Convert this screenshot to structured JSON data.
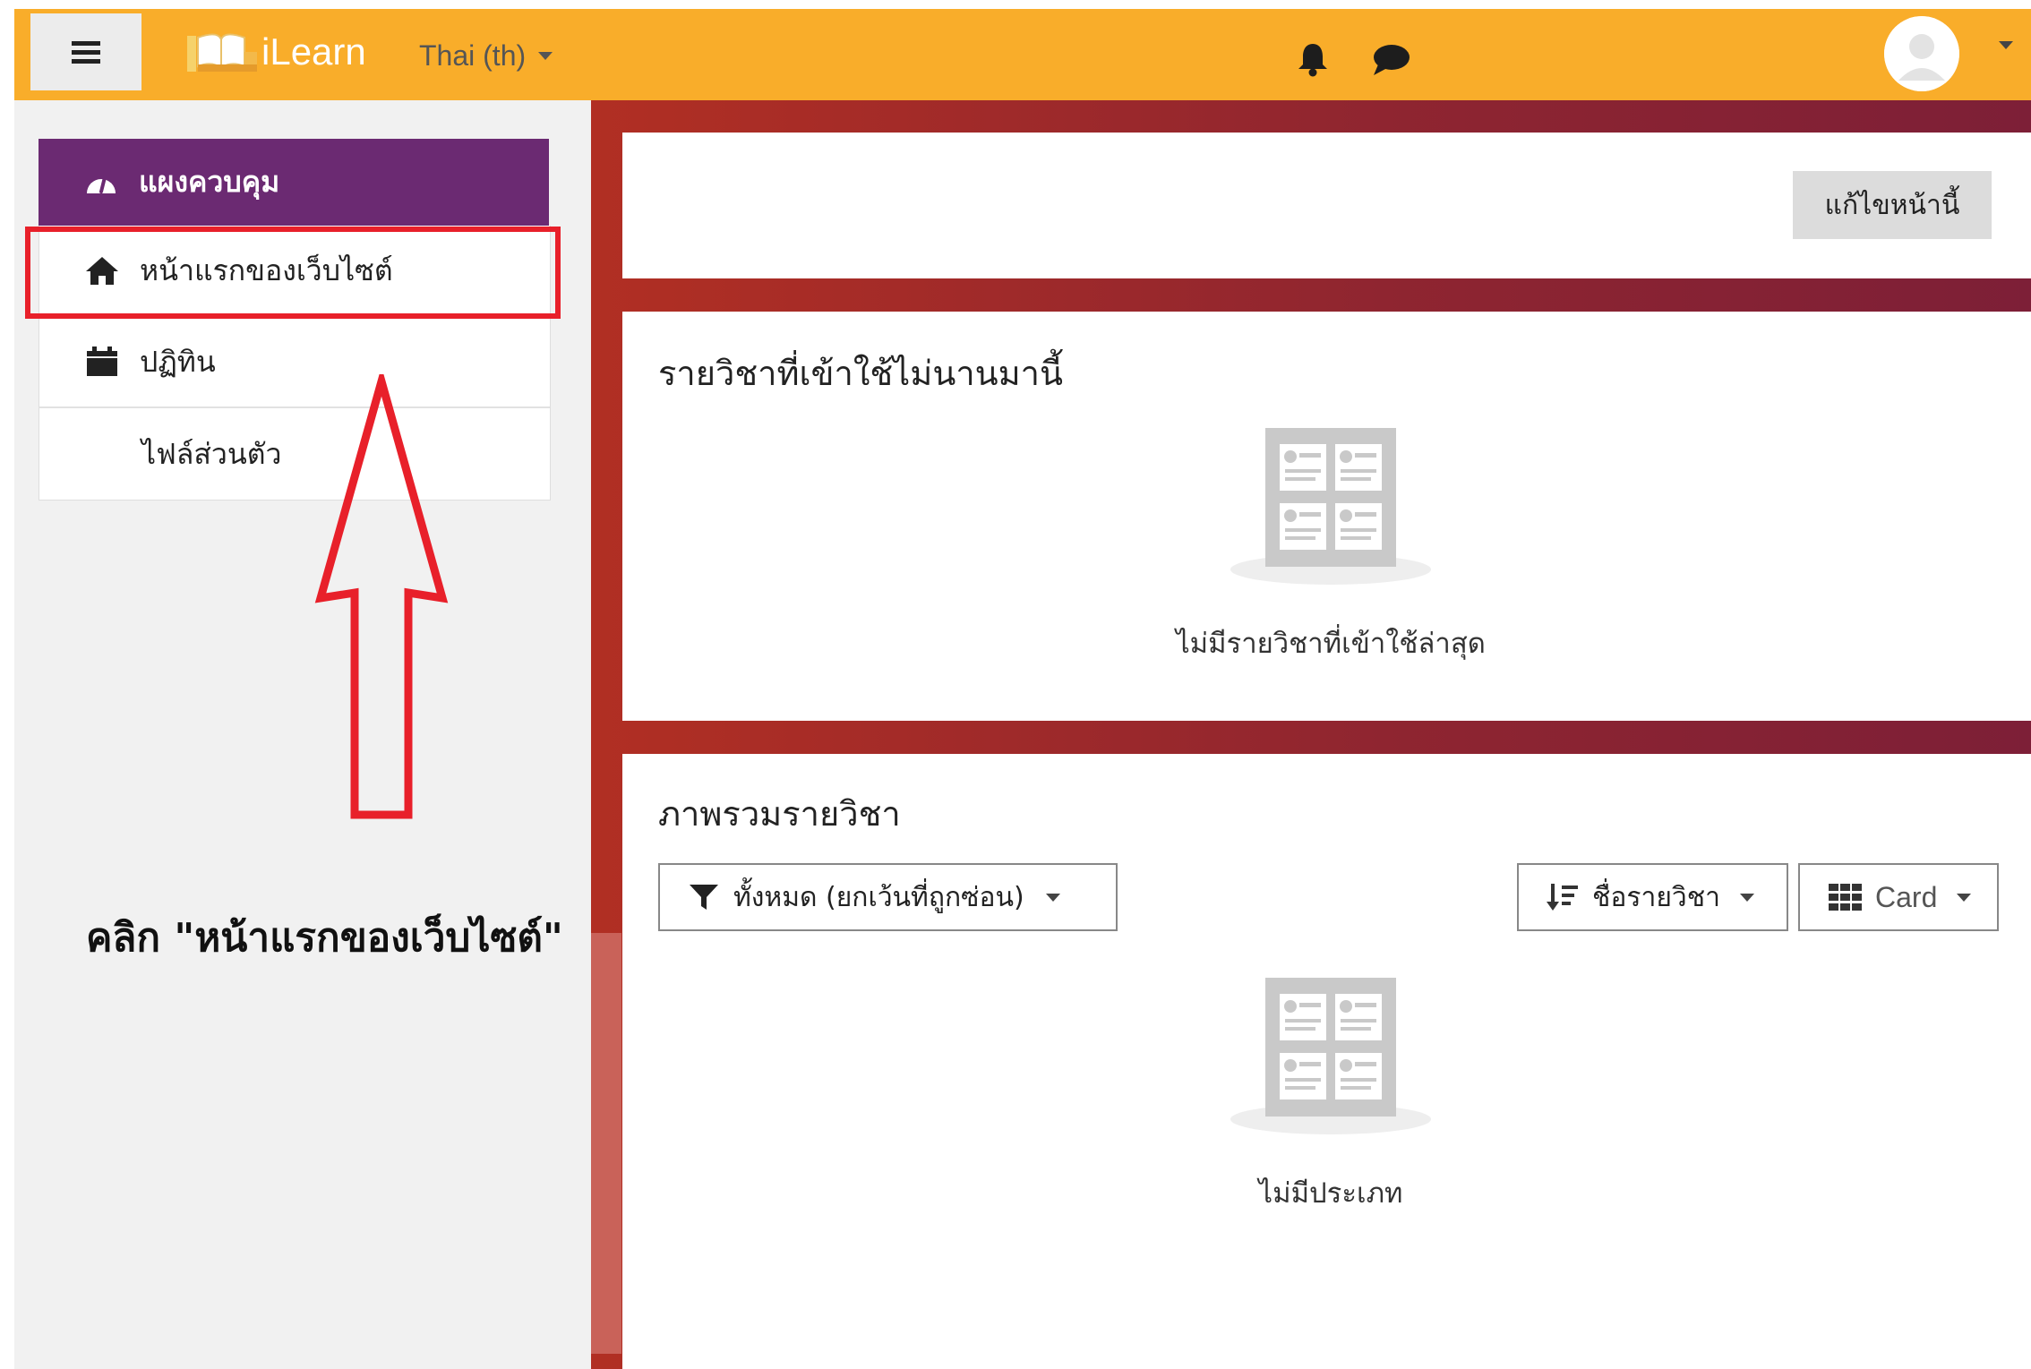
{
  "header": {
    "brand_name": "iLearn",
    "language": "Thai (th)",
    "icons": [
      "hamburger-menu-icon",
      "book-logo-icon",
      "bell-icon",
      "chat-icon",
      "user-avatar-icon"
    ],
    "color": "#f9ad2a"
  },
  "sidebar": {
    "header_label": "แผงควบคุม",
    "header_color": "#6b2a72",
    "items": [
      {
        "label": "หน้าแรกของเว็บไซต์",
        "icon": "home-icon"
      },
      {
        "label": "ปฏิทิน",
        "icon": "calendar-icon"
      },
      {
        "label": "ไฟล์ส่วนตัว"
      }
    ]
  },
  "annotation": {
    "instruction": "คลิก \"หน้าแรกของเว็บไซต์\"",
    "color": "#e8202a"
  },
  "page": {
    "edit_button": "แก้ไขหน้านี้"
  },
  "recent": {
    "title": "รายวิชาที่เข้าใช้ไม่นานมานี้",
    "empty_text": "ไม่มีรายวิชาที่เข้าใช้ล่าสุด"
  },
  "overview": {
    "title": "ภาพรวมรายวิชา",
    "filter_label": "ทั้งหมด (ยกเว้นที่ถูกซ่อน)",
    "sort_label": "ชื่อรายวิชา",
    "view_label": "Card",
    "empty_text": "ไม่มีประเภท"
  }
}
